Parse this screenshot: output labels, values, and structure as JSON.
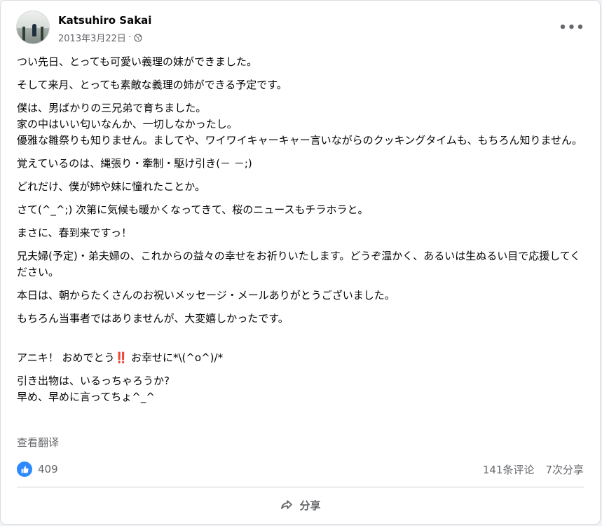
{
  "post": {
    "author": "Katsuhiro Sakai",
    "date": "2013年3月22日",
    "separator": "·",
    "more_label": "•••",
    "paragraphs": [
      "つい先日、とっても可愛い義理の妹ができました。",
      "そして来月、とっても素敵な義理の姉ができる予定です。",
      "僕は、男ばかりの三兄弟で育ちました。\n家の中はいい匂いなんか、一切しなかったし。\n優雅な雛祭りも知りません。ましてや、ワイワイキャーキャー言いながらのクッキングタイムも、もちろん知りません。",
      "覚えているのは、縄張り・牽制・駆け引き(－ －;)",
      "どれだけ、僕が姉や妹に憧れたことか。",
      "さて(^_^;) 次第に気候も暖かくなってきて、桜のニュースもチラホラと。",
      "まさに、春到来ですっ！",
      "兄夫婦(予定)・弟夫婦の、これからの益々の幸せをお祈りいたします。どうぞ温かく、あるいは生ぬるい目で応援してください。",
      "本日は、朝からたくさんのお祝いメッセージ・メールありがとうございました。",
      "もちろん当事者ではありませんが、大変嬉しかったです。"
    ],
    "congrats": {
      "before": "アニキ！ おめでとう",
      "emoji": "‼️",
      "after": " お幸せに*\\(^o^)/*"
    },
    "closing": "引き出物は、いるっちゃろうか?\n早め、早めに言ってちょ^_^",
    "translate_label": "查看翻译",
    "reaction_count": "409",
    "comments_label": "141条评论",
    "shares_label": "7次分享",
    "share_button": "分享"
  },
  "colors": {
    "accent": "#2e89ff",
    "secondary_text": "#65676b",
    "divider": "#ced0d4"
  },
  "icons": {
    "header_more": "more-horizontal-icon",
    "audience": "globe-icon",
    "reaction": "like-icon",
    "share": "share-arrow-icon"
  }
}
